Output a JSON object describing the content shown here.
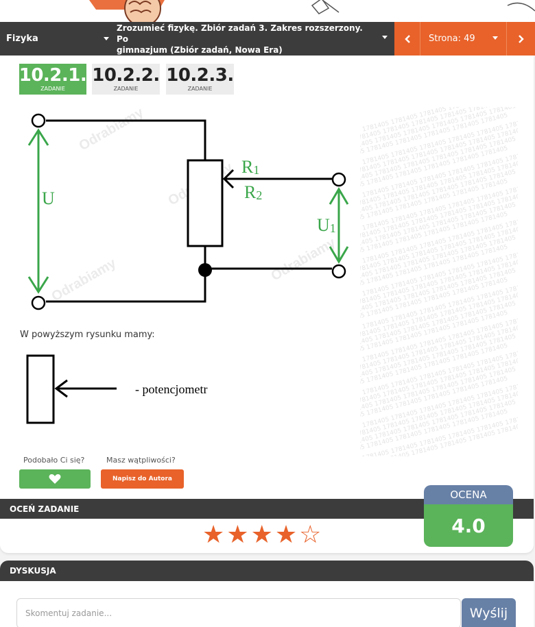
{
  "nav": {
    "subject": "Fizyka",
    "book_line1": "Zrozumieć fizykę. Zbiór zadań 3. Zakres rozszerzony. Po",
    "book_line2": "gimnazjum (Zbiór zadań, Nowa Era)",
    "page": "Strona: 49"
  },
  "tabs": [
    {
      "number": "10.2.1.",
      "label": "ZADANIE",
      "active": true
    },
    {
      "number": "10.2.2.",
      "label": "ZADANIE",
      "active": false
    },
    {
      "number": "10.2.3.",
      "label": "ZADANIE",
      "active": false
    }
  ],
  "diagram": {
    "label_U": "U",
    "label_R": "R",
    "label_R1_sub": "1",
    "label_R2_sub": "2",
    "label_U1": "U",
    "label_U1_sub": "1",
    "watermark_brand": "Odrabiamy",
    "watermark_code": "1781405",
    "colors": {
      "wire": "#000000",
      "arrow": "#3aa64a",
      "label": "#3aa64a"
    }
  },
  "description": "W powyższym rysunku mamy:",
  "legend_text": "- potencjometr",
  "feedback": {
    "like_question": "Podobało Ci się?",
    "doubt_question": "Masz wątpliwości?",
    "author_button": "Napisz do Autora"
  },
  "rating": {
    "header": "OCEŃ ZADANIE",
    "stars_filled": 4,
    "stars_total": 5,
    "score_label": "OCENA",
    "score_value": "4.0"
  },
  "discussion": {
    "header": "DYSKUSJA",
    "comment_placeholder": "Skomentuj zadanie...",
    "send_label": "Wyślij"
  },
  "colors": {
    "green": "#5bb35a",
    "orange": "#e8622a",
    "dark": "#3c3c3c",
    "blue": "#6780a6"
  }
}
